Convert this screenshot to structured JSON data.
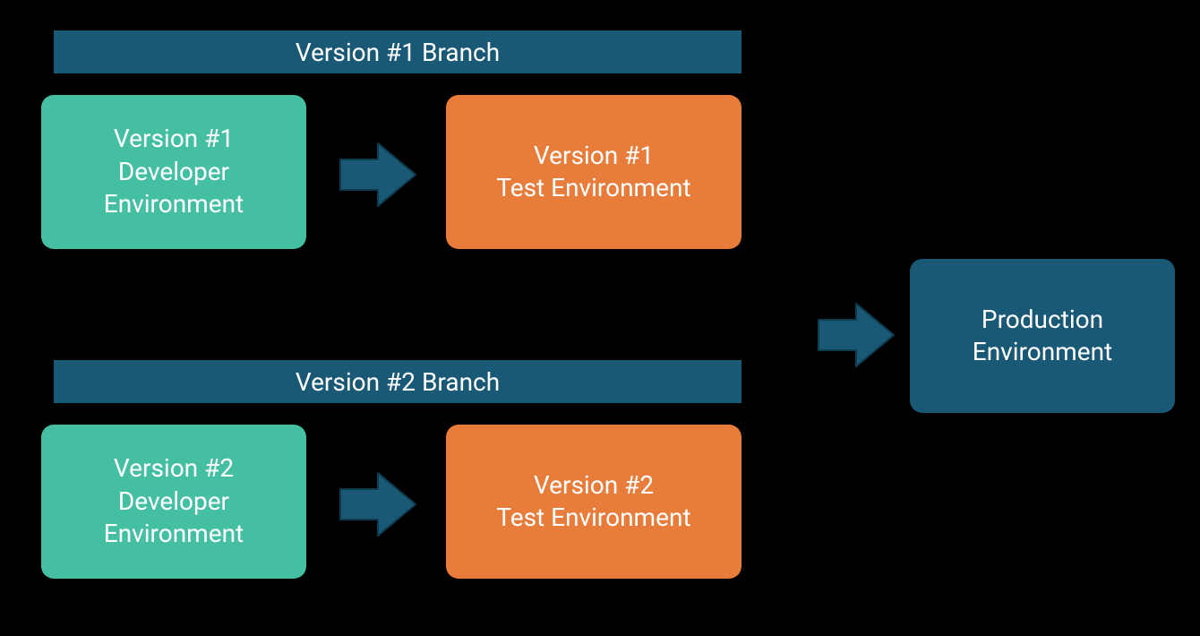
{
  "colors": {
    "branchHeader": "#1a5975",
    "devBox": "#45bfa2",
    "testBox": "#e87c3a",
    "prodBox": "#1a5975",
    "arrow": "#1a5975",
    "arrowStroke": "#0d3c50",
    "background": "#000000",
    "text": "#ffffff"
  },
  "branch1": {
    "header": "Version #1 Branch",
    "dev": "Version #1\nDeveloper\nEnvironment",
    "test": "Version #1\nTest Environment"
  },
  "branch2": {
    "header": "Version #2 Branch",
    "dev": "Version #2\nDeveloper\nEnvironment",
    "test": "Version #2\nTest Environment"
  },
  "production": "Production\nEnvironment"
}
